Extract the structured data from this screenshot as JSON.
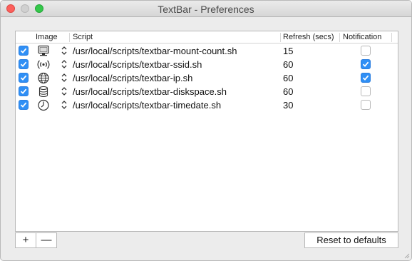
{
  "window": {
    "title": "TextBar - Preferences"
  },
  "table": {
    "columns": {
      "image": "Image",
      "script": "Script",
      "refresh": "Refresh (secs)",
      "notification": "Notification"
    },
    "rows": [
      {
        "enabled": true,
        "icon": "display-icon",
        "script": "/usr/local/scripts/textbar-mount-count.sh",
        "refresh": "15",
        "notification": false
      },
      {
        "enabled": true,
        "icon": "wifi-signal-icon",
        "script": "/usr/local/scripts/textbar-ssid.sh",
        "refresh": "60",
        "notification": true
      },
      {
        "enabled": true,
        "icon": "globe-icon",
        "script": "/usr/local/scripts/textbar-ip.sh",
        "refresh": "60",
        "notification": true
      },
      {
        "enabled": true,
        "icon": "database-icon",
        "script": "/usr/local/scripts/textbar-diskspace.sh",
        "refresh": "60",
        "notification": false
      },
      {
        "enabled": true,
        "icon": "clock-icon",
        "script": "/usr/local/scripts/textbar-timedate.sh",
        "refresh": "30",
        "notification": false
      }
    ]
  },
  "buttons": {
    "add": "+",
    "remove": "—",
    "reset": "Reset to defaults"
  },
  "colors": {
    "accent": "#2f8ff5",
    "close": "#fc605c",
    "maximize": "#34c84a"
  }
}
